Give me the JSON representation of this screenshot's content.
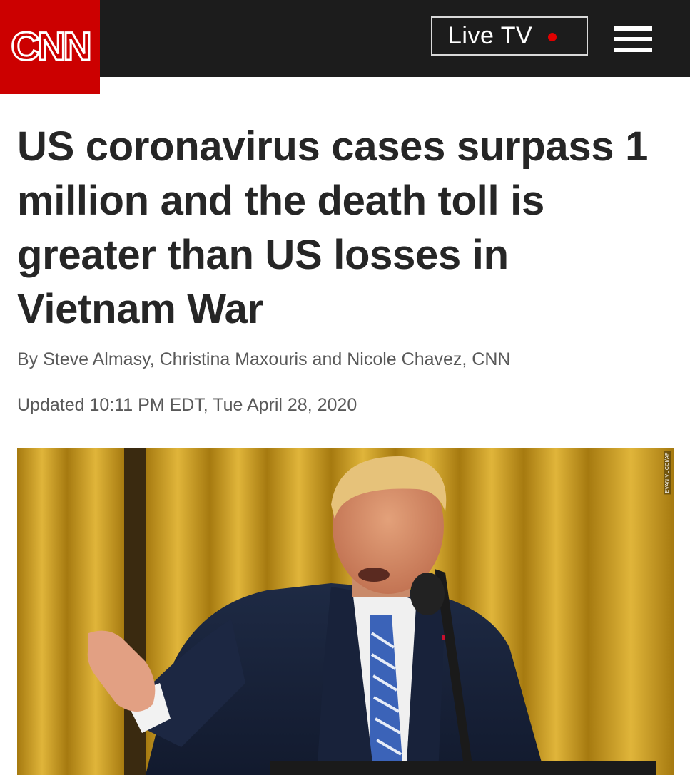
{
  "header": {
    "logo_text": "CNN",
    "live_tv_label": "Live TV",
    "menu_icon": "hamburger-menu-icon",
    "colors": {
      "brand_red": "#cc0000",
      "bar": "#1c1c1c",
      "live_dot": "#e00000"
    }
  },
  "article": {
    "headline": "US coronavirus cases surpass 1 million and the death toll is greater than US losses in Vietnam War",
    "byline": "By Steve Almasy, Christina Maxouris and Nicole Chavez, CNN",
    "updated": "Updated 10:11 PM EDT, Tue April 28, 2020"
  },
  "photo": {
    "credit": "EVAN VUCCI/AP"
  }
}
